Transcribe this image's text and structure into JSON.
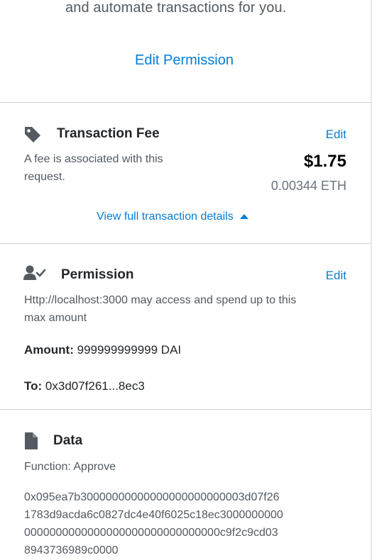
{
  "top": {
    "description_tail": "and automate transactions for you.",
    "edit_permission_label": "Edit Permission"
  },
  "fee": {
    "title": "Transaction Fee",
    "edit_label": "Edit",
    "description_line1": "A fee is associated with this",
    "description_line2": "request.",
    "fiat_amount": "$1.75",
    "eth_amount": "0.00344 ETH",
    "view_details_label": "View full transaction details"
  },
  "permission": {
    "title": "Permission",
    "edit_label": "Edit",
    "description_line1": "Http://localhost:3000 may access and spend up to this",
    "description_line2": "max amount",
    "amount_label": "Amount:",
    "amount_value": "999999999999 DAI",
    "to_label": "To:",
    "to_value": "0x3d07f261...8ec3"
  },
  "data": {
    "title": "Data",
    "function_label": "Function: Approve",
    "hex_lines": [
      "0x095ea7b30000000000000000000000003d07f26",
      "1783d9acda6c0827dc4e40f6025c18ec3000000000",
      "0000000000000000000000000000000c9f2c9cd03",
      "8943736989c0000"
    ]
  },
  "colors": {
    "link": "#037dd6",
    "text_primary": "#24272a",
    "text_secondary": "#535a61",
    "divider": "#cfd3d7"
  },
  "icons": {
    "fee": "tag-icon",
    "permission": "user-check-icon",
    "data": "document-icon",
    "view_details": "caret-up-icon"
  }
}
